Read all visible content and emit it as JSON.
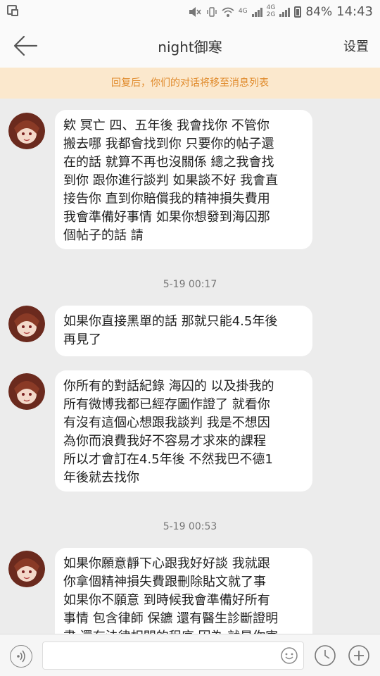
{
  "status_bar": {
    "network_label_1": "4G",
    "network_label_2": "4G",
    "network_label_3": "2G",
    "battery": "84%",
    "time": "14:43",
    "icons": [
      "screenshot-icon",
      "mute-icon",
      "vibrate-icon",
      "wifi-icon",
      "signal-icon",
      "battery-icon"
    ]
  },
  "header": {
    "back_icon": "back-arrow-icon",
    "title": "night御寒",
    "settings": "设置"
  },
  "notice": "回复后，你们的对话将移至消息列表",
  "messages": [
    {
      "type": "message",
      "avatar": "avatar-icon",
      "text": "欸  冥亡  四、五年後 我會找你 不管你\n搬去哪 我都會找到你 只要你的帖子還\n在的話 就算不再也沒關係 總之我會找\n到你 跟你進行談判 如果談不好 我會直\n接告你   直到你賠償我的精神損失費用\n我會準備好事情 如果你想發到海囚那\n個帖子的話 請"
    },
    {
      "type": "time",
      "text": "5-19 00:17"
    },
    {
      "type": "message",
      "avatar": "avatar-icon",
      "text": "如果你直接黑單的話 那就只能4.5年後\n再見了"
    },
    {
      "type": "message",
      "avatar": "avatar-icon",
      "text": "你所有的對話紀錄 海囚的 以及掛我的\n所有微博我都已經存圖作證了 就看你\n有沒有這個心想跟我談判 我是不想因\n為你而浪費我好不容易才求來的課程\n所以才會訂在4.5年後 不然我巴不德1\n年後就去找你"
    },
    {
      "type": "time",
      "text": "5-19 00:53"
    },
    {
      "type": "message",
      "avatar": "avatar-icon",
      "text": "如果你願意靜下心跟我好好談 我就跟\n你拿個精神損失費跟刪除貼文就了事\n如果你不願意 到時候我會準備好所有\n事情 包含律師 保鑣 還有醫生診斷證明\n書 還有法律相關的程序 因為 就是你害"
    }
  ],
  "input_bar": {
    "voice_icon": "voice-icon",
    "placeholder": "",
    "emoji_icon": "emoji-icon",
    "clock_icon": "clock-icon",
    "plus_icon": "plus-icon"
  },
  "colors": {
    "notice_bg": "#fbe8cd",
    "notice_text": "#e08a2b",
    "chat_bg": "#ececec",
    "bubble_bg": "#ffffff"
  }
}
